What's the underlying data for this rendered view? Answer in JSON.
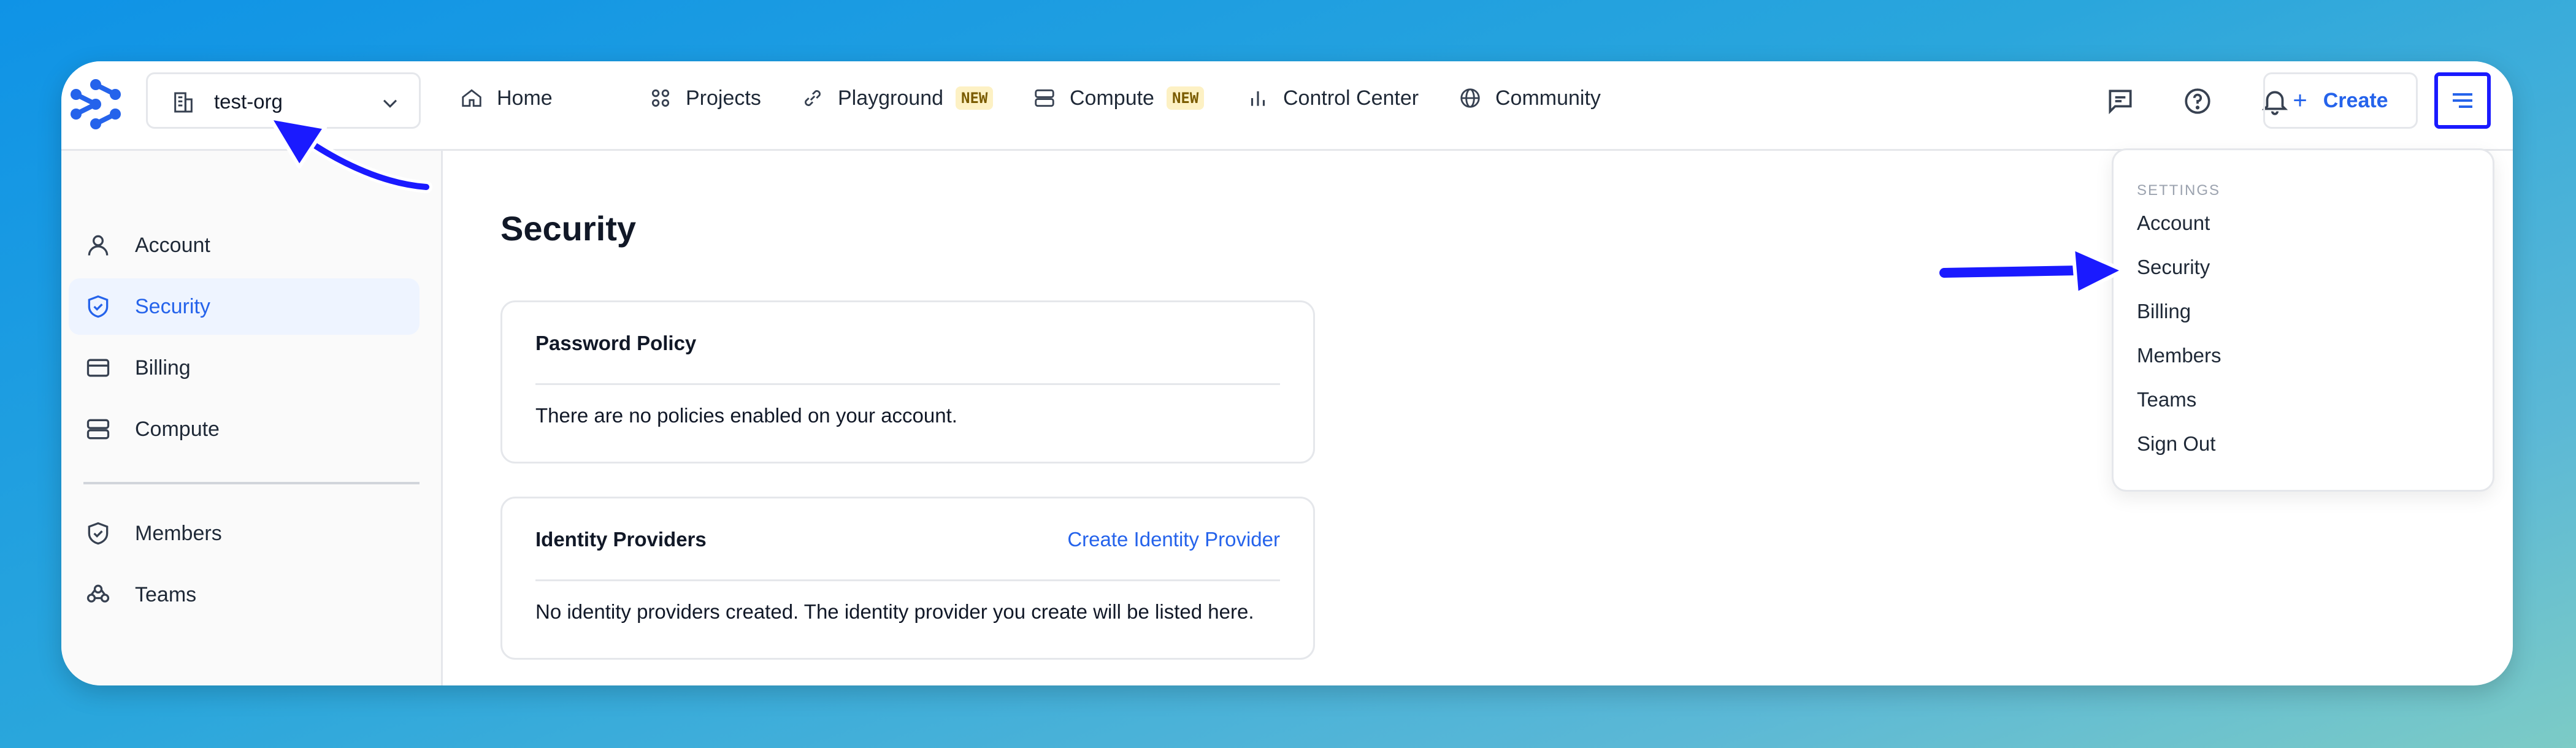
{
  "header": {
    "org_name": "test-org",
    "nav": [
      {
        "label": "Home",
        "icon": "home-icon"
      },
      {
        "label": "Projects",
        "icon": "grid-icon"
      },
      {
        "label": "Playground",
        "icon": "link-icon",
        "badge": "NEW"
      },
      {
        "label": "Compute",
        "icon": "server-icon",
        "badge": "NEW"
      },
      {
        "label": "Control Center",
        "icon": "bar-chart-icon"
      },
      {
        "label": "Community",
        "icon": "globe-icon"
      }
    ],
    "create_label": "Create"
  },
  "sidebar": {
    "items": [
      {
        "label": "Account",
        "icon": "user-icon"
      },
      {
        "label": "Security",
        "icon": "shield-check-icon",
        "active": true
      },
      {
        "label": "Billing",
        "icon": "credit-card-icon"
      },
      {
        "label": "Compute",
        "icon": "server-icon"
      },
      {
        "label": "Members",
        "icon": "shield-check-icon"
      },
      {
        "label": "Teams",
        "icon": "team-icon"
      }
    ]
  },
  "main": {
    "title": "Security",
    "password_policy": {
      "title": "Password Policy",
      "text": "There are no policies enabled on your account."
    },
    "identity_providers": {
      "title": "Identity Providers",
      "link": "Create Identity Provider",
      "text": "No identity providers created. The identity provider you create will be listed here."
    }
  },
  "dropdown": {
    "heading": "SETTINGS",
    "items": [
      "Account",
      "Security",
      "Billing",
      "Members",
      "Teams",
      "Sign Out"
    ]
  },
  "colors": {
    "accent": "#2563eb",
    "annotation": "#1a1aff",
    "badge_bg": "#fdf1c4"
  }
}
